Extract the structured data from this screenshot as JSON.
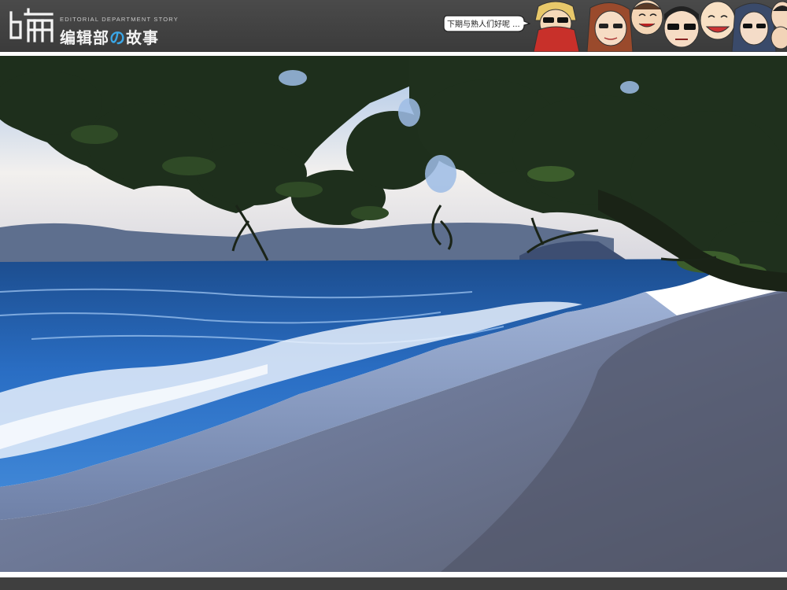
{
  "header": {
    "logo_subtitle": "EDITORIAL DEPARTMENT STORY",
    "logo_title_part1": "编辑部",
    "logo_title_accent": "の",
    "logo_title_part2": "故事",
    "speech_bubble_text": "下期与熟人们好呢 ..."
  },
  "colors": {
    "header_bg": "#444444",
    "accent": "#3aa6e6",
    "sea": "#1f5fb0",
    "sand": "#6f7f9c",
    "foliage": "#1e2f1c"
  },
  "photo": {
    "subject": "beach-at-dusk",
    "icon_names": [
      "logo-icon",
      "speech-bubble-icon",
      "cartoon-faces-icon"
    ]
  }
}
